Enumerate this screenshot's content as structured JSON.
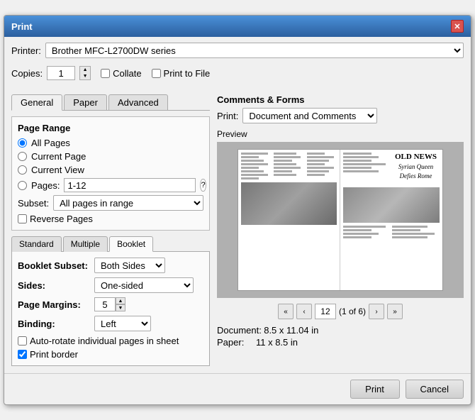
{
  "title_bar": {
    "title": "Print",
    "close_label": "✕"
  },
  "printer": {
    "label": "Printer:",
    "value": "Brother MFC-L2700DW series"
  },
  "copies": {
    "label": "Copies:",
    "value": "1"
  },
  "collate": {
    "label": "Collate",
    "checked": false
  },
  "print_to_file": {
    "label": "Print to File",
    "checked": false
  },
  "tabs": {
    "general": "General",
    "paper": "Paper",
    "advanced": "Advanced"
  },
  "page_range": {
    "title": "Page Range",
    "all_pages": "All Pages",
    "current_page": "Current Page",
    "current_view": "Current View",
    "pages_label": "Pages:",
    "pages_value": "1-12",
    "help": "?",
    "subset_label": "Subset:",
    "subset_value": "All pages in range",
    "reverse_pages": "Reverse Pages"
  },
  "booklet_tabs": {
    "standard": "Standard",
    "multiple": "Multiple",
    "booklet": "Booklet"
  },
  "booklet": {
    "subset_label": "Booklet Subset:",
    "subset_value": "Both Sides",
    "sides_label": "Sides:",
    "sides_value": "One-sided",
    "margins_label": "Page Margins:",
    "margins_value": "5",
    "binding_label": "Binding:",
    "binding_value": "Left",
    "auto_rotate": "Auto-rotate individual pages in sheet",
    "print_border": "Print border"
  },
  "comments_forms": {
    "title": "Comments & Forms",
    "print_label": "Print:",
    "print_value": "Document and Comments"
  },
  "preview": {
    "title": "Preview",
    "headline": "OLD NEWS",
    "subheadline1": "Syrian Queen",
    "subheadline2": "Defies Rome",
    "page_number": "12",
    "page_info": "(1 of 6)"
  },
  "document_info": {
    "doc_label": "Document:",
    "doc_value": "8.5 x 11.04 in",
    "paper_label": "Paper:",
    "paper_value": "11 x 8.5 in"
  },
  "buttons": {
    "print": "Print",
    "cancel": "Cancel"
  },
  "nav": {
    "first": "«",
    "prev": "‹",
    "next": "›",
    "last": "»"
  }
}
